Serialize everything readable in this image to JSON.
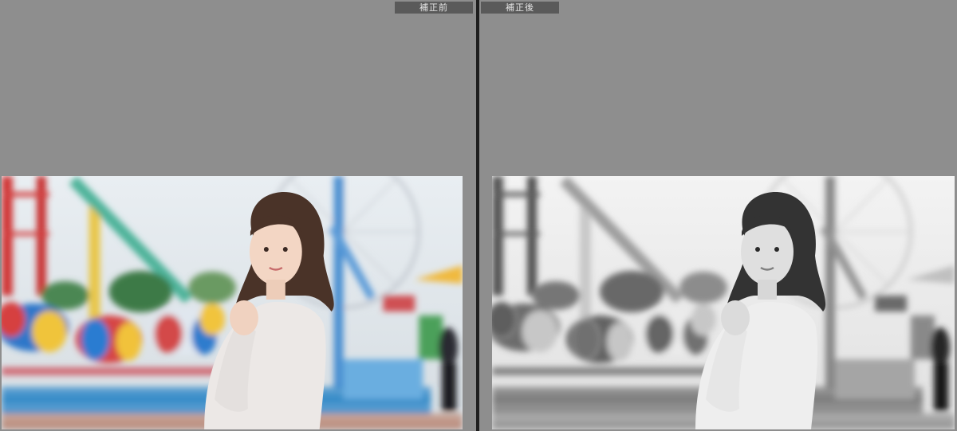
{
  "before_label": "補正前",
  "after_label": "補正後",
  "photo_subject": "woman-amusement-park-icon",
  "colors": {
    "workspace_bg": "#8e8e8e",
    "label_bg": "#5a5a5a",
    "divider": "#1e1e1e"
  }
}
